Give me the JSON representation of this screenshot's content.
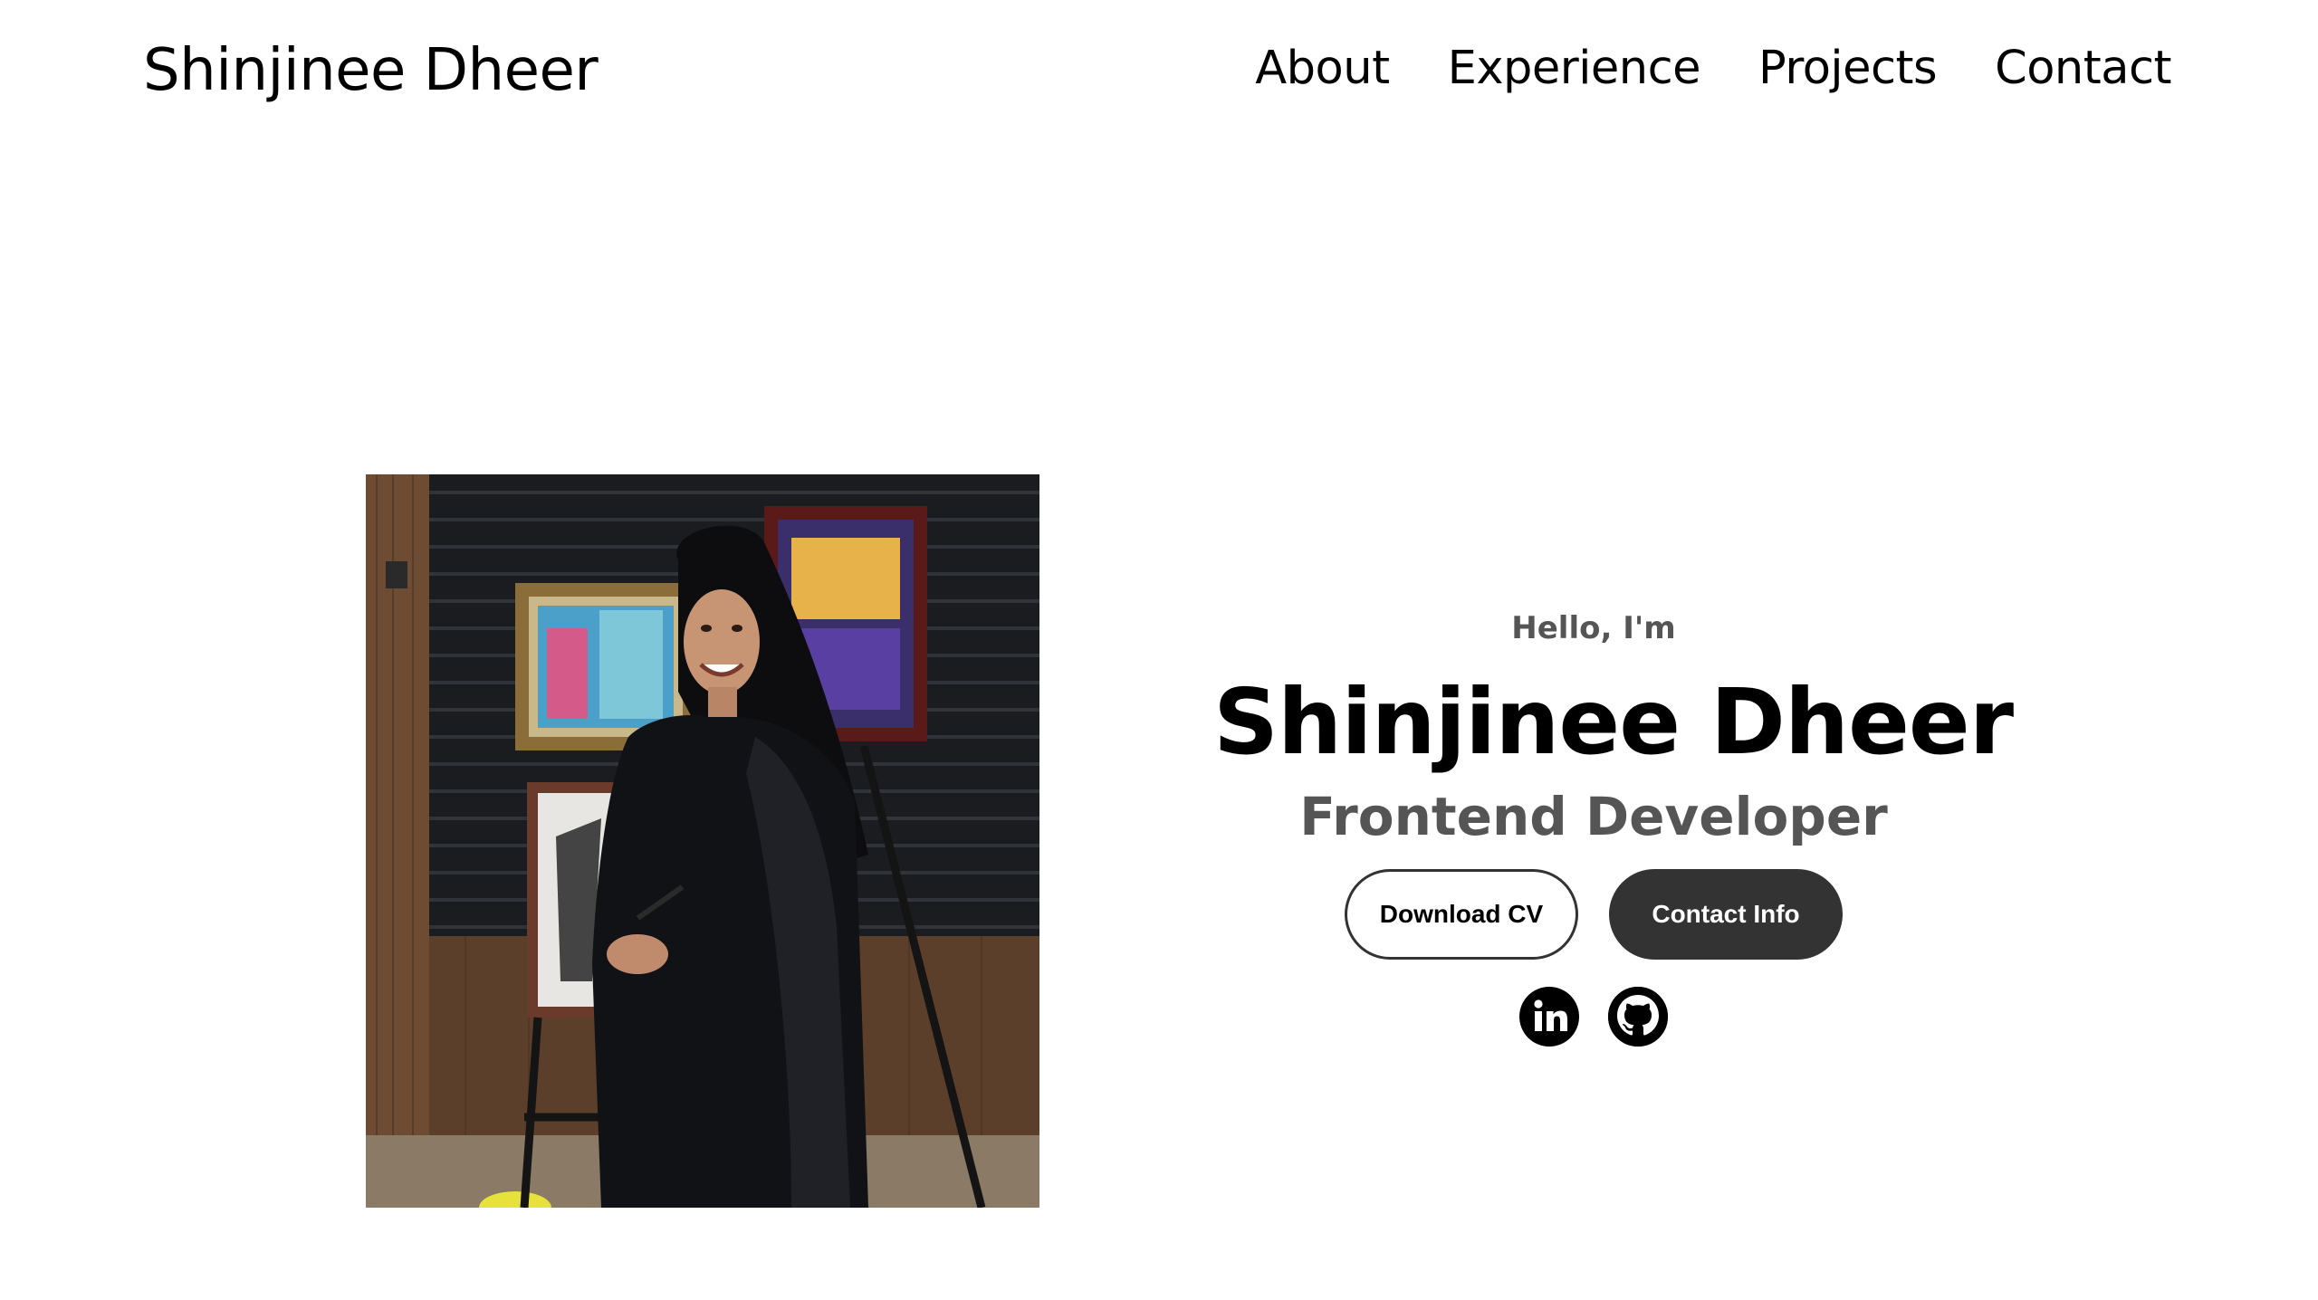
{
  "nav": {
    "logo": "Shinjinee Dheer",
    "links": [
      "About",
      "Experience",
      "Projects",
      "Contact"
    ]
  },
  "hero": {
    "greeting": "Hello, I'm",
    "name": "Shinjinee Dheer",
    "role": "Frontend Developer",
    "buttons": {
      "download": "Download CV",
      "contact": "Contact Info"
    },
    "socials": [
      "linkedin-icon",
      "github-icon"
    ]
  },
  "colors": {
    "text": "#000000",
    "muted": "#555555",
    "button_dark": "#333333",
    "background": "#ffffff"
  }
}
